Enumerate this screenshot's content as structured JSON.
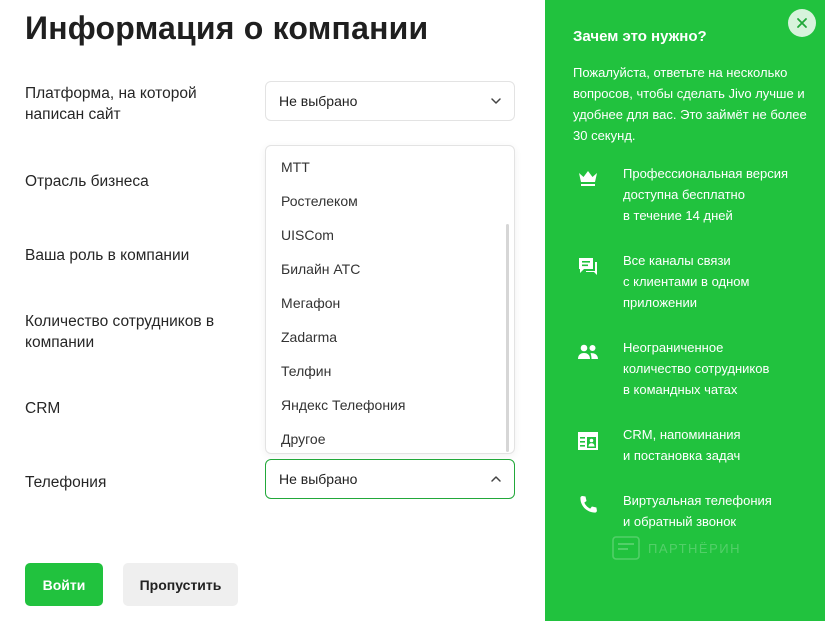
{
  "page": {
    "title": "Информация о компании"
  },
  "form": {
    "platform": {
      "label": "Платформа, на которой написан сайт",
      "value": "Не выбрано"
    },
    "industry": {
      "label": "Отрасль бизнеса"
    },
    "role": {
      "label": "Ваша роль в компании"
    },
    "employees": {
      "label": "Количество сотрудников в компании"
    },
    "crm": {
      "label": "CRM"
    },
    "telephony": {
      "label": "Телефония",
      "value": "Не выбрано"
    }
  },
  "dropdown": {
    "options": [
      "МТТ",
      "Ростелеком",
      "UISCom",
      "Билайн АТС",
      "Мегафон",
      "Zadarma",
      "Телфин",
      "Яндекс Телефония",
      "Другое"
    ]
  },
  "buttons": {
    "login": "Войти",
    "skip": "Пропустить"
  },
  "panel": {
    "heading": "Зачем это нужно?",
    "description": "Пожалуйста, ответьте на несколько вопросов, чтобы сделать Jivo лучше и удобнее для вас. Это займёт не более 30 секунд.",
    "features": [
      {
        "icon": "crown-icon",
        "lines": [
          "Профессиональная версия",
          "доступна бесплатно",
          "в течение 14 дней"
        ]
      },
      {
        "icon": "chat-icon",
        "lines": [
          "Все каналы связи",
          "с клиентами в одном",
          "приложении"
        ]
      },
      {
        "icon": "users-icon",
        "lines": [
          "Неограниченное",
          "количество сотрудников",
          "в командных чатах"
        ]
      },
      {
        "icon": "crm-card-icon",
        "lines": [
          "CRM, напоминания",
          "и постановка задач"
        ]
      },
      {
        "icon": "phone-icon",
        "lines": [
          "Виртуальная телефония",
          "и обратный звонок"
        ]
      }
    ],
    "watermark": "ПАРТНЁРИН"
  },
  "colors": {
    "accent": "#21c23e",
    "panel_bg": "#21c23e",
    "secondary_button": "#efefef"
  }
}
